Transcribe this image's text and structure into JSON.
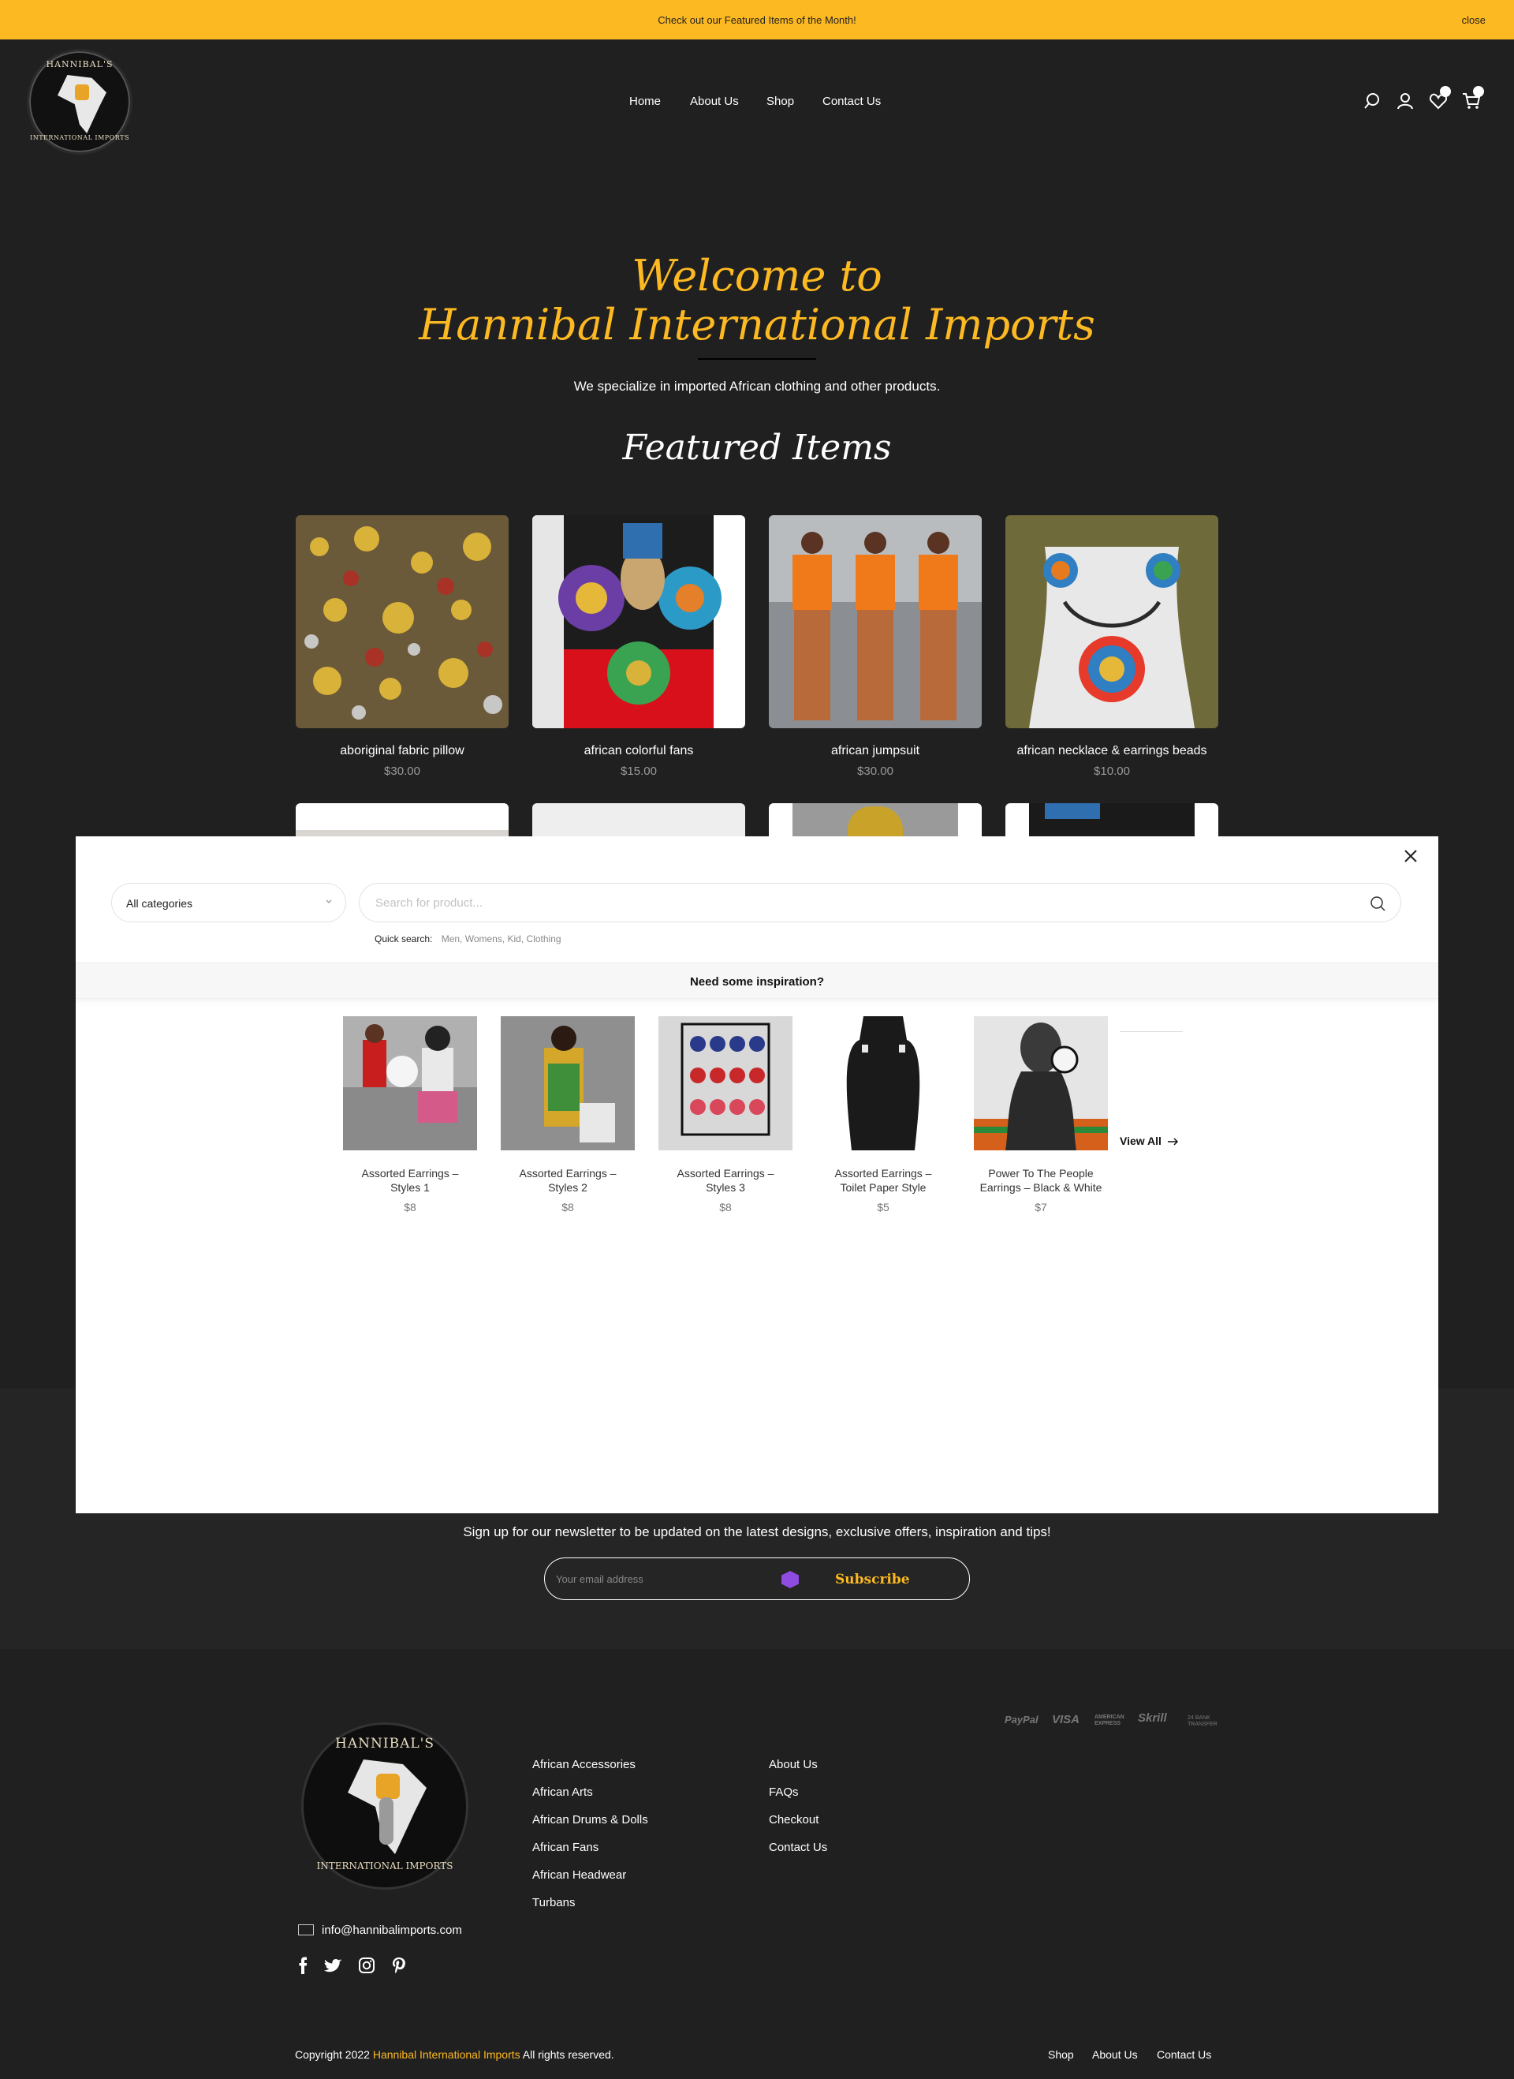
{
  "announcement": {
    "message": "Check out our Featured Items of the Month!",
    "close_label": "close"
  },
  "logo": {
    "top_text": "HANNIBAL'S",
    "bottom_text": "INTERNATIONAL IMPORTS"
  },
  "nav": {
    "items": [
      "Home",
      "About Us",
      "Shop",
      "Contact Us"
    ]
  },
  "header_icons": [
    "search-icon",
    "user-icon",
    "heart-icon",
    "cart-icon"
  ],
  "hero": {
    "title_line1": "Welcome to",
    "title_line2": "Hannibal International Imports",
    "subtitle": "We specialize in imported African clothing and other products.",
    "featured_title": "Featured Items"
  },
  "products": [
    {
      "name": "aboriginal fabric pillow",
      "price": "$30.00"
    },
    {
      "name": "african colorful fans",
      "price": "$15.00"
    },
    {
      "name": "african jumpsuit",
      "price": "$30.00"
    },
    {
      "name": "african necklace & earrings beads",
      "price": "$10.00"
    }
  ],
  "search_modal": {
    "category_label": "All categories",
    "search_placeholder": "Search for product...",
    "quick_search_label": "Quick search:",
    "quick_search_values": "Men, Womens, Kid, Clothing",
    "inspiration_title": "Need some inspiration?",
    "view_all_label": "View All",
    "suggestions": [
      {
        "name_line1": "Assorted Earrings –",
        "name_line2": "Styles 1",
        "price": "$8"
      },
      {
        "name_line1": "Assorted Earrings –",
        "name_line2": "Styles 2",
        "price": "$8"
      },
      {
        "name_line1": "Assorted Earrings –",
        "name_line2": "Styles 3",
        "price": "$8"
      },
      {
        "name_line1": "Assorted Earrings –",
        "name_line2": "Toilet Paper Style",
        "price": "$5"
      },
      {
        "name_line1": "Power To The People",
        "name_line2": "Earrings – Black & White",
        "price": "$7"
      }
    ]
  },
  "newsletter": {
    "text": "Sign up for our newsletter to be updated on the latest designs, exclusive offers, inspiration and tips!",
    "email_placeholder": "Your email address",
    "button_label": "Subscribe"
  },
  "footer": {
    "categories": [
      "African Accessories",
      "African Arts",
      "African Drums & Dolls",
      "African Fans",
      "African Headwear",
      "Turbans"
    ],
    "info_links": [
      "About Us",
      "FAQs",
      "Checkout",
      "Contact Us"
    ],
    "email": "info@hannibalimports.com",
    "social_icons": [
      "facebook-icon",
      "twitter-icon",
      "instagram-icon",
      "pinterest-icon"
    ],
    "payments": {
      "paypal": "PayPal",
      "visa": "VISA",
      "amex_line1": "AMERICAN",
      "amex_line2": "EXPRESS",
      "skrill": "Skrill",
      "bank_line1": "24 BANK",
      "bank_line2": "TRANSFER"
    },
    "copyright_prefix": "Copyright 2022",
    "copyright_brand": "Hannibal International Imports",
    "copyright_suffix": "All rights reserved.",
    "bottom_links": [
      "Shop",
      "About Us",
      "Contact Us"
    ]
  },
  "colors": {
    "accent": "#fdb921",
    "background": "#202020",
    "modal_bg": "#ffffff"
  }
}
